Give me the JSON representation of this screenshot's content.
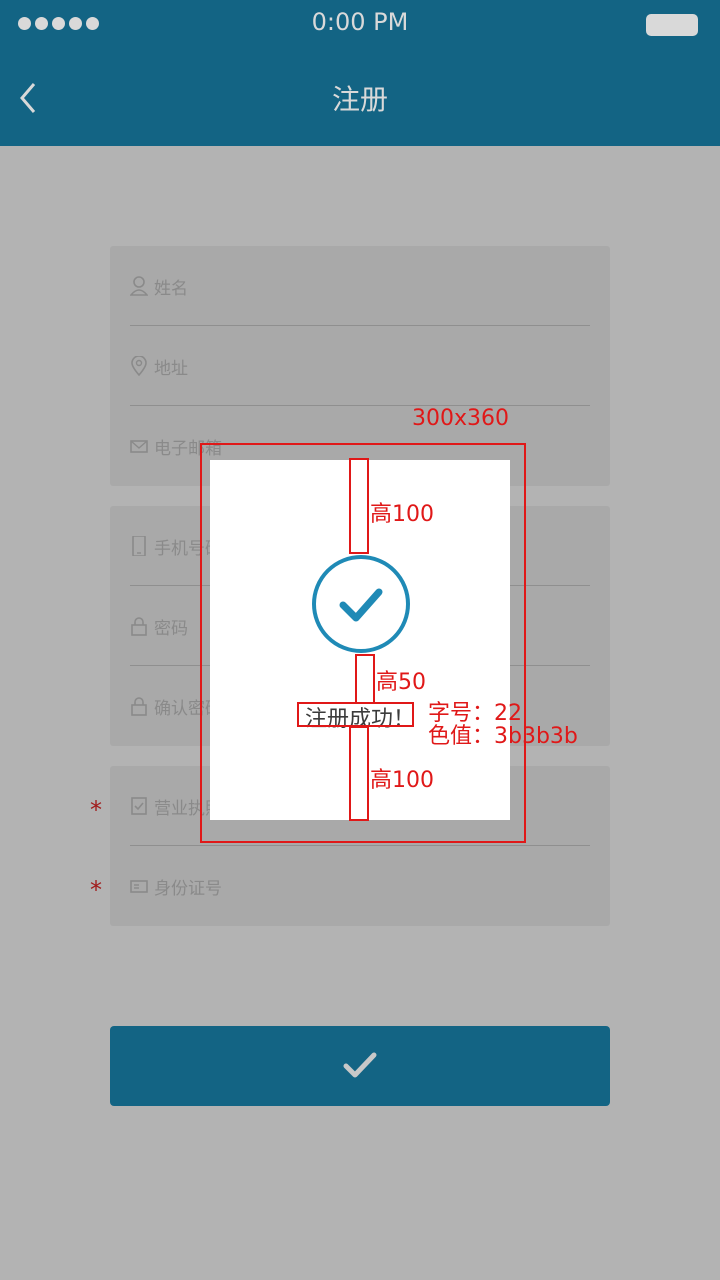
{
  "status_bar": {
    "time": "0:00 PM"
  },
  "header": {
    "title": "注册"
  },
  "form": {
    "card1": [
      "姓名",
      "地址",
      "电子邮箱"
    ],
    "card2": [
      "手机号码",
      "密码",
      "确认密码"
    ],
    "card3": [
      "营业执照",
      "身份证号"
    ],
    "required_mark": "*"
  },
  "dialog": {
    "message": "注册成功！"
  },
  "annotations": {
    "size": "300x360",
    "top_gap": "高100",
    "middle_gap": "高50",
    "bottom_gap": "高100",
    "font_size": "字号：22",
    "color_value": "色值：3b3b3b"
  },
  "colors": {
    "header": "#136484",
    "text": "#3b3b3b",
    "annotation": "#e01818"
  }
}
